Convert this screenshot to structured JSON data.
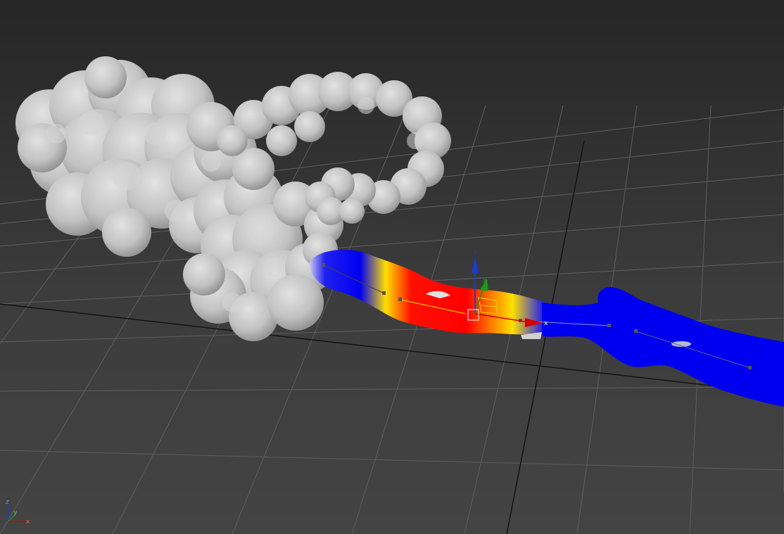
{
  "viewport": {
    "background_top": "#262626",
    "background_bottom": "#444444",
    "grid_color": "#5e5e5e",
    "grid_major_color": "#111111"
  },
  "molecule": {
    "surface_color": "#c8c8c8"
  },
  "channel": {
    "colors": {
      "low": "#0000f0",
      "mid": "#ffe000",
      "high": "#ff0000"
    }
  },
  "gizmo": {
    "x_label": "x",
    "y_label": "y",
    "z_label": "z",
    "x_color": "#d40000",
    "y_color": "#1a9a1a",
    "z_color": "#1a3ad0",
    "plane_color": "#f0d000"
  },
  "view_cube": {
    "x_label": "x",
    "y_label": "y",
    "z_label": "z"
  }
}
